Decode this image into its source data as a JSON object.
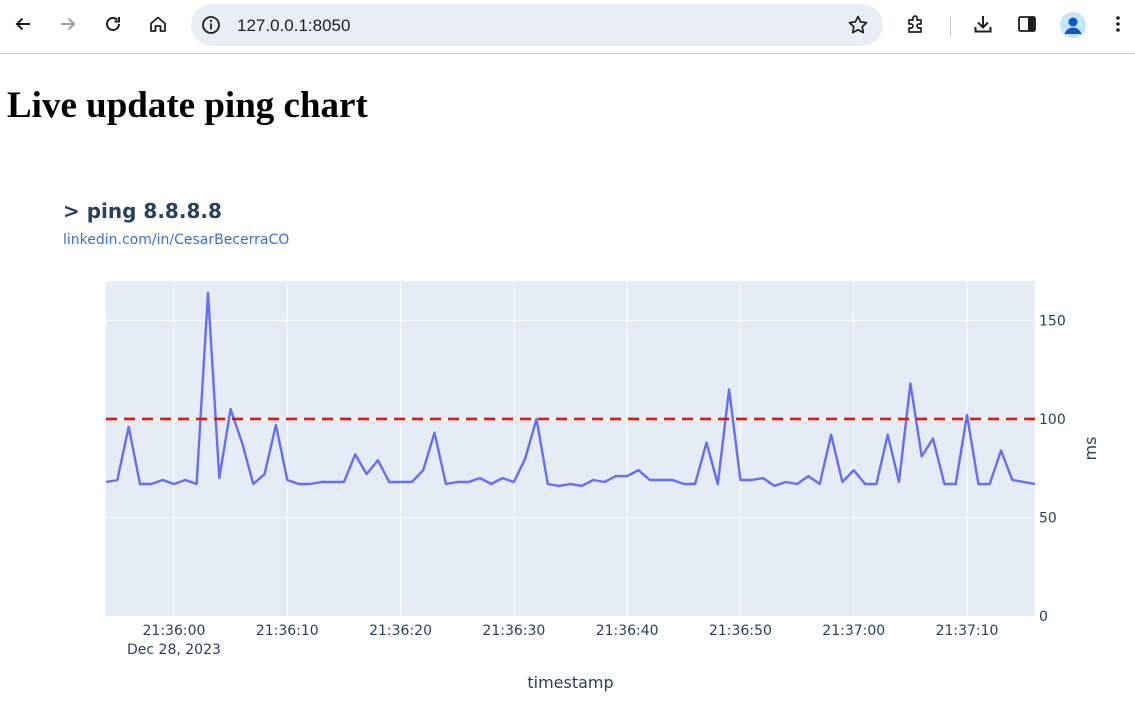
{
  "browser": {
    "url": "127.0.0.1:8050"
  },
  "page": {
    "title": "Live update ping chart"
  },
  "chart_data": {
    "type": "line",
    "title": "> ping 8.8.8.8",
    "subtitle": "linkedin.com/in/CesarBecerraCO",
    "xlabel": "timestamp",
    "ylabel": "ms",
    "y_axis_side": "right",
    "ylim": [
      0,
      170
    ],
    "yticks": [
      0,
      50,
      100,
      150
    ],
    "xlim": [
      "2023-12-28 21:35:54",
      "2023-12-28 21:37:16"
    ],
    "xticks": [
      {
        "t": "2023-12-28 21:36:00",
        "label": "21:36:00",
        "sublabel": "Dec 28, 2023"
      },
      {
        "t": "2023-12-28 21:36:10",
        "label": "21:36:10"
      },
      {
        "t": "2023-12-28 21:36:20",
        "label": "21:36:20"
      },
      {
        "t": "2023-12-28 21:36:30",
        "label": "21:36:30"
      },
      {
        "t": "2023-12-28 21:36:40",
        "label": "21:36:40"
      },
      {
        "t": "2023-12-28 21:36:50",
        "label": "21:36:50"
      },
      {
        "t": "2023-12-28 21:37:00",
        "label": "21:37:00"
      },
      {
        "t": "2023-12-28 21:37:10",
        "label": "21:37:10"
      }
    ],
    "grid": true,
    "threshold": {
      "y": 100,
      "color": "#ee1111",
      "style": "dashed"
    },
    "series": [
      {
        "color": "#636efa",
        "points": [
          [
            "2023-12-28 21:35:54.0",
            68
          ],
          [
            "2023-12-28 21:35:55.0",
            69
          ],
          [
            "2023-12-28 21:35:56.0",
            96
          ],
          [
            "2023-12-28 21:35:57.0",
            67
          ],
          [
            "2023-12-28 21:35:58.0",
            67
          ],
          [
            "2023-12-28 21:35:59.0",
            69
          ],
          [
            "2023-12-28 21:36:00.0",
            67
          ],
          [
            "2023-12-28 21:36:01.0",
            69
          ],
          [
            "2023-12-28 21:36:02.0",
            67
          ],
          [
            "2023-12-28 21:36:03.0",
            164
          ],
          [
            "2023-12-28 21:36:04.0",
            70
          ],
          [
            "2023-12-28 21:36:05.0",
            105
          ],
          [
            "2023-12-28 21:36:06.0",
            88
          ],
          [
            "2023-12-28 21:36:07.0",
            67
          ],
          [
            "2023-12-28 21:36:08.0",
            72
          ],
          [
            "2023-12-28 21:36:09.0",
            97
          ],
          [
            "2023-12-28 21:36:10.0",
            69
          ],
          [
            "2023-12-28 21:36:11.0",
            67
          ],
          [
            "2023-12-28 21:36:12.0",
            67
          ],
          [
            "2023-12-28 21:36:13.0",
            68
          ],
          [
            "2023-12-28 21:36:14.0",
            68
          ],
          [
            "2023-12-28 21:36:15.0",
            68
          ],
          [
            "2023-12-28 21:36:16.0",
            82
          ],
          [
            "2023-12-28 21:36:17.0",
            72
          ],
          [
            "2023-12-28 21:36:18.0",
            79
          ],
          [
            "2023-12-28 21:36:19.0",
            68
          ],
          [
            "2023-12-28 21:36:20.0",
            68
          ],
          [
            "2023-12-28 21:36:21.0",
            68
          ],
          [
            "2023-12-28 21:36:22.0",
            74
          ],
          [
            "2023-12-28 21:36:23.0",
            93
          ],
          [
            "2023-12-28 21:36:24.0",
            67
          ],
          [
            "2023-12-28 21:36:25.0",
            68
          ],
          [
            "2023-12-28 21:36:26.0",
            68
          ],
          [
            "2023-12-28 21:36:27.0",
            70
          ],
          [
            "2023-12-28 21:36:28.0",
            67
          ],
          [
            "2023-12-28 21:36:29.0",
            70
          ],
          [
            "2023-12-28 21:36:30.0",
            68
          ],
          [
            "2023-12-28 21:36:31.0",
            80
          ],
          [
            "2023-12-28 21:36:32.0",
            100
          ],
          [
            "2023-12-28 21:36:33.0",
            67
          ],
          [
            "2023-12-28 21:36:34.0",
            66
          ],
          [
            "2023-12-28 21:36:35.0",
            67
          ],
          [
            "2023-12-28 21:36:36.0",
            66
          ],
          [
            "2023-12-28 21:36:37.0",
            69
          ],
          [
            "2023-12-28 21:36:38.0",
            68
          ],
          [
            "2023-12-28 21:36:39.0",
            71
          ],
          [
            "2023-12-28 21:36:40.0",
            71
          ],
          [
            "2023-12-28 21:36:41.0",
            74
          ],
          [
            "2023-12-28 21:36:42.0",
            69
          ],
          [
            "2023-12-28 21:36:43.0",
            69
          ],
          [
            "2023-12-28 21:36:44.0",
            69
          ],
          [
            "2023-12-28 21:36:45.0",
            67
          ],
          [
            "2023-12-28 21:36:46.0",
            67
          ],
          [
            "2023-12-28 21:36:47.0",
            88
          ],
          [
            "2023-12-28 21:36:48.0",
            67
          ],
          [
            "2023-12-28 21:36:49.0",
            115
          ],
          [
            "2023-12-28 21:36:50.0",
            69
          ],
          [
            "2023-12-28 21:36:51.0",
            69
          ],
          [
            "2023-12-28 21:36:52.0",
            70
          ],
          [
            "2023-12-28 21:36:53.0",
            66
          ],
          [
            "2023-12-28 21:36:54.0",
            68
          ],
          [
            "2023-12-28 21:36:55.0",
            67
          ],
          [
            "2023-12-28 21:36:56.0",
            71
          ],
          [
            "2023-12-28 21:36:57.0",
            67
          ],
          [
            "2023-12-28 21:36:58.0",
            92
          ],
          [
            "2023-12-28 21:36:59.0",
            68
          ],
          [
            "2023-12-28 21:37:00.0",
            74
          ],
          [
            "2023-12-28 21:37:01.0",
            67
          ],
          [
            "2023-12-28 21:37:02.0",
            67
          ],
          [
            "2023-12-28 21:37:03.0",
            92
          ],
          [
            "2023-12-28 21:37:04.0",
            68
          ],
          [
            "2023-12-28 21:37:05.0",
            118
          ],
          [
            "2023-12-28 21:37:06.0",
            81
          ],
          [
            "2023-12-28 21:37:07.0",
            90
          ],
          [
            "2023-12-28 21:37:08.0",
            67
          ],
          [
            "2023-12-28 21:37:09.0",
            67
          ],
          [
            "2023-12-28 21:37:10.0",
            102
          ],
          [
            "2023-12-28 21:37:11.0",
            67
          ],
          [
            "2023-12-28 21:37:12.0",
            67
          ],
          [
            "2023-12-28 21:37:13.0",
            84
          ],
          [
            "2023-12-28 21:37:14.0",
            69
          ],
          [
            "2023-12-28 21:37:15.0",
            68
          ],
          [
            "2023-12-28 21:37:16.0",
            67
          ]
        ]
      }
    ]
  },
  "colors": {
    "plot_background": "#e5ecf6",
    "series": "#636efa",
    "threshold": "#ee1111",
    "text": "#2a3f5f",
    "link": "#3a6fd8"
  },
  "icons": [
    "back-arrow-icon",
    "forward-arrow-icon",
    "reload-icon",
    "home-icon",
    "site-info-icon",
    "bookmark-star-icon",
    "extensions-puzzle-icon",
    "downloads-icon",
    "side-panel-icon",
    "profile-avatar-icon",
    "more-menu-icon"
  ]
}
